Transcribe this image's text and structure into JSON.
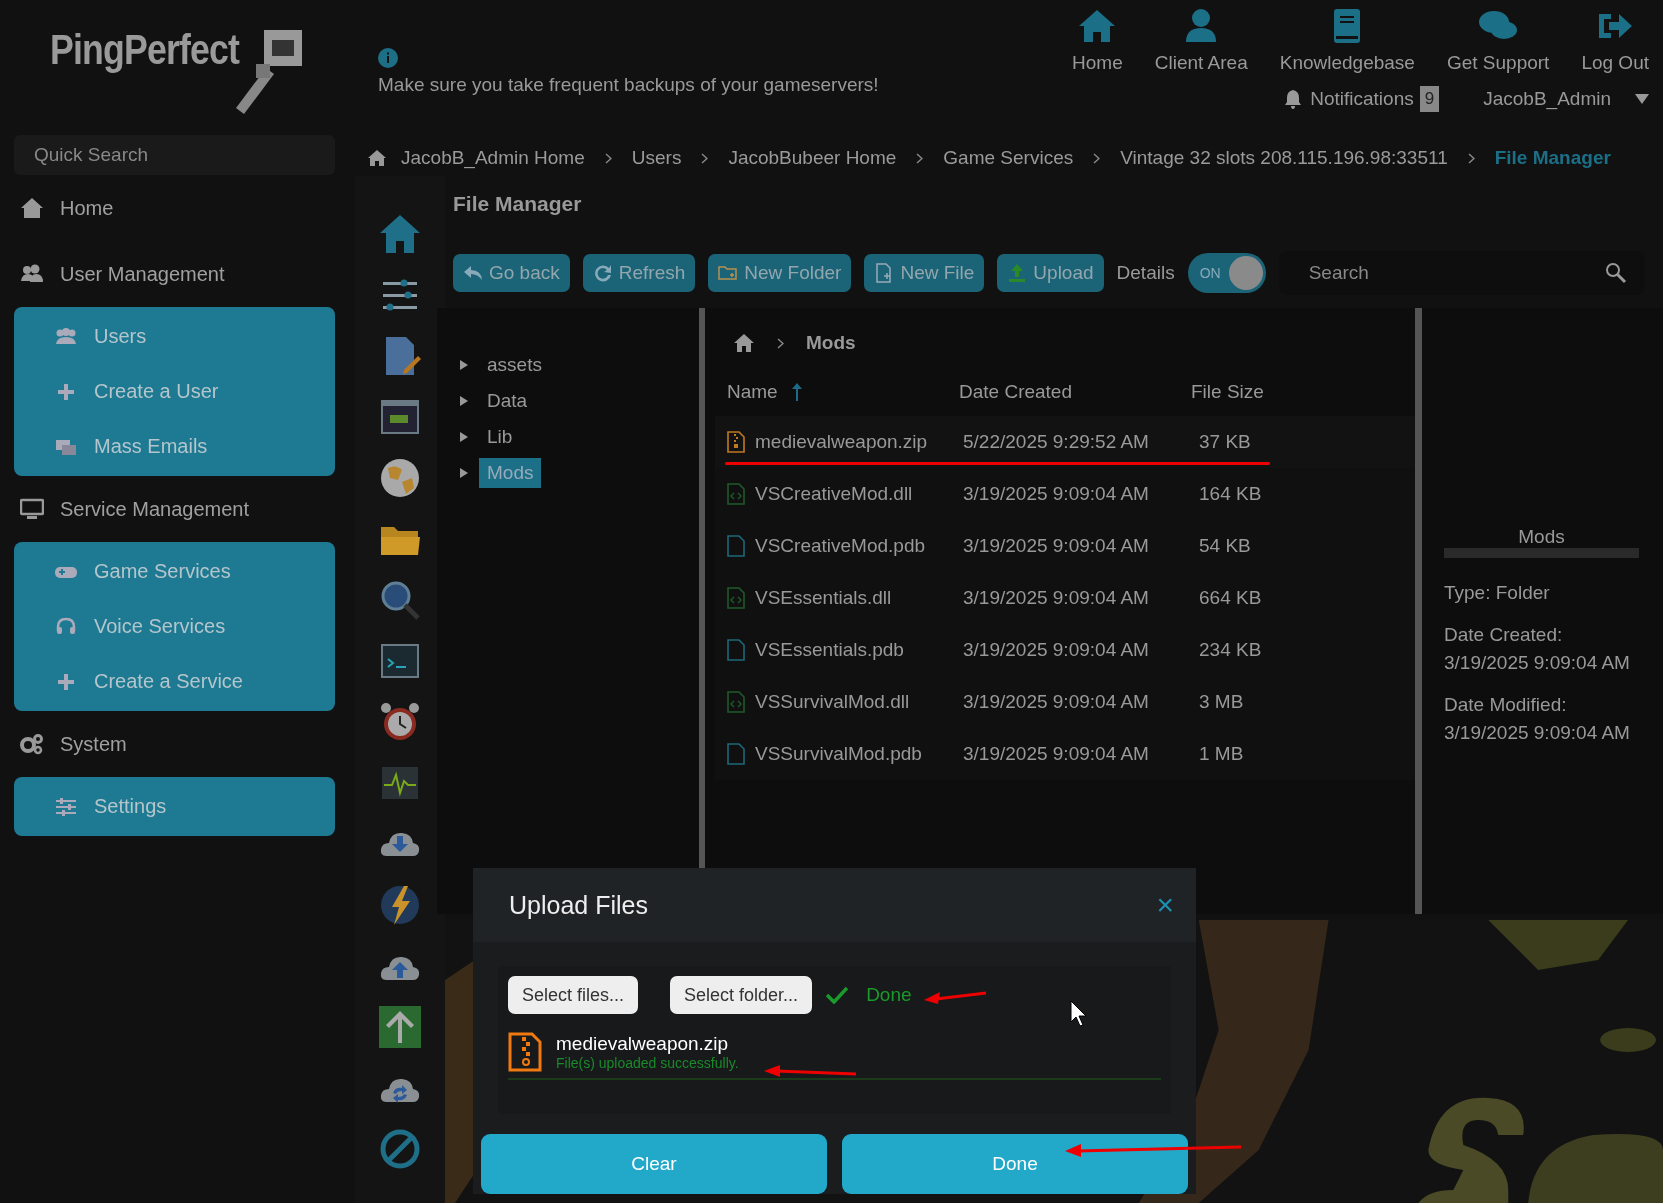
{
  "logo": {
    "text": "PingPerfect"
  },
  "notice": {
    "text": "Make sure you take frequent backups of your gameservers!"
  },
  "top_nav": [
    {
      "label": "Home",
      "kind": "home"
    },
    {
      "label": "Client Area",
      "kind": "user"
    },
    {
      "label": "Knowledgebase",
      "kind": "book"
    },
    {
      "label": "Get Support",
      "kind": "chat"
    },
    {
      "label": "Log Out",
      "kind": "logout"
    }
  ],
  "notifications": {
    "label": "Notifications",
    "count": "9"
  },
  "user": {
    "name": "JacobB_Admin"
  },
  "sidebar": {
    "search": {
      "placeholder": "Quick Search"
    },
    "sections": [
      {
        "label": "Home",
        "kind": "home"
      },
      {
        "label": "User Management",
        "kind": "users",
        "items": [
          {
            "label": "Users",
            "kind": "users"
          },
          {
            "label": "Create a User",
            "kind": "plus"
          },
          {
            "label": "Mass Emails",
            "kind": "mail"
          }
        ]
      },
      {
        "label": "Service Management",
        "kind": "monitor",
        "items": [
          {
            "label": "Game Services",
            "kind": "gamepad"
          },
          {
            "label": "Voice Services",
            "kind": "headset"
          },
          {
            "label": "Create a Service",
            "kind": "plus"
          }
        ]
      },
      {
        "label": "System",
        "kind": "gears",
        "items": [
          {
            "label": "Settings",
            "kind": "sliders"
          }
        ]
      }
    ]
  },
  "breadcrumb": [
    {
      "label": "JacobB_Admin Home",
      "selected": false
    },
    {
      "label": "Users",
      "selected": false
    },
    {
      "label": "JacobBubeer Home",
      "selected": false
    },
    {
      "label": "Game Services",
      "selected": false
    },
    {
      "label": "Vintage 32 slots 208.115.196.98:33511",
      "selected": false
    },
    {
      "label": "File Manager",
      "selected": true
    }
  ],
  "page_title": "File Manager",
  "toolbar": {
    "buttons": [
      {
        "label": "Go back",
        "kind": "back"
      },
      {
        "label": "Refresh",
        "kind": "refresh"
      },
      {
        "label": "New Folder",
        "kind": "folder"
      },
      {
        "label": "New File",
        "kind": "file"
      },
      {
        "label": "Upload",
        "kind": "upload"
      }
    ],
    "details": {
      "label": "Details",
      "on": true,
      "state_text": "ON"
    },
    "search": {
      "placeholder": "Search"
    }
  },
  "tree": [
    {
      "label": "assets",
      "expanded": false,
      "selected": false
    },
    {
      "label": "Data",
      "expanded": false,
      "selected": false
    },
    {
      "label": "Lib",
      "expanded": false,
      "selected": false
    },
    {
      "label": "Mods",
      "expanded": false,
      "selected": true
    }
  ],
  "path": {
    "current": "Mods"
  },
  "table": {
    "columns": [
      {
        "label": "Name",
        "sorted": true
      },
      {
        "label": "Date Created",
        "sorted": false
      },
      {
        "label": "File Size",
        "sorted": false
      }
    ],
    "rows": [
      {
        "name": "medievalweapon.zip",
        "date": "5/22/2025 9:29:52 AM",
        "size": "37 KB",
        "kind": "zip",
        "underlined": true
      },
      {
        "name": "VSCreativeMod.dll",
        "date": "3/19/2025 9:09:04 AM",
        "size": "164 KB",
        "kind": "dll",
        "underlined": false
      },
      {
        "name": "VSCreativeMod.pdb",
        "date": "3/19/2025 9:09:04 AM",
        "size": "54 KB",
        "kind": "pdb",
        "underlined": false
      },
      {
        "name": "VSEssentials.dll",
        "date": "3/19/2025 9:09:04 AM",
        "size": "664 KB",
        "kind": "dll",
        "underlined": false
      },
      {
        "name": "VSEssentials.pdb",
        "date": "3/19/2025 9:09:04 AM",
        "size": "234 KB",
        "kind": "pdb",
        "underlined": false
      },
      {
        "name": "VSSurvivalMod.dll",
        "date": "3/19/2025 9:09:04 AM",
        "size": "3 MB",
        "kind": "dll",
        "underlined": false
      },
      {
        "name": "VSSurvivalMod.pdb",
        "date": "3/19/2025 9:09:04 AM",
        "size": "1 MB",
        "kind": "pdb",
        "underlined": false
      }
    ]
  },
  "details_panel": {
    "title": "Mods",
    "fields": [
      {
        "label": "Type: Folder"
      },
      {
        "label": "Date Created:",
        "value": "3/19/2025 9:09:04 AM"
      },
      {
        "label": "Date Modified:",
        "value": "3/19/2025 9:09:04 AM"
      }
    ]
  },
  "upload_dialog": {
    "title": "Upload Files",
    "close": "×",
    "pickers": [
      "Select files...",
      "Select folder..."
    ],
    "status": "Done",
    "files": [
      {
        "name": "medievalweapon.zip",
        "message": "File(s) uploaded successfully."
      }
    ],
    "actions": [
      "Clear",
      "Done"
    ]
  }
}
